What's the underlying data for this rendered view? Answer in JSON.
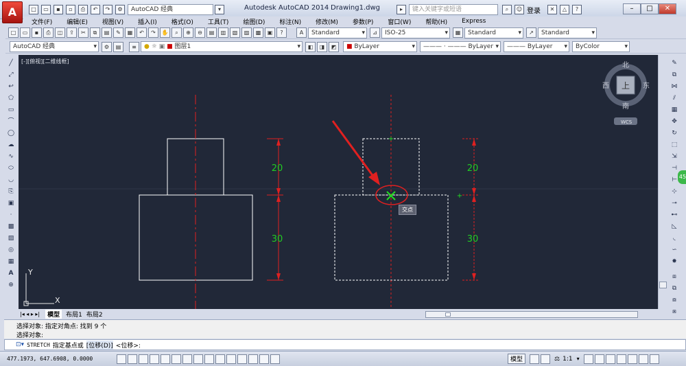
{
  "app": {
    "title": "Autodesk AutoCAD 2014",
    "document": "Drawing1.dwg",
    "workspace": "AutoCAD 经典",
    "search_placeholder": "键入关键字或短语",
    "login_label": "登录",
    "help_icon": "?"
  },
  "menu": [
    "文件(F)",
    "编辑(E)",
    "视图(V)",
    "插入(I)",
    "格式(O)",
    "工具(T)",
    "绘图(D)",
    "标注(N)",
    "修改(M)",
    "参数(P)",
    "窗口(W)",
    "帮助(H)",
    "Express"
  ],
  "styles": {
    "text_style": "Standard",
    "dim_style": "ISO-25",
    "table_style": "Standard",
    "multileader_style": "Standard"
  },
  "layers": {
    "workspace": "AutoCAD 经典",
    "current_layer": "图层1",
    "color": "ByLayer",
    "linetype": "ByLayer",
    "lineweight": "ByLayer",
    "plotstyle": "ByColor"
  },
  "viewport": {
    "label": "[-][俯视][二维线框]",
    "viewcube": {
      "north": "北",
      "south": "南",
      "east": "东",
      "west": "西",
      "top": "上",
      "wcs": "WCS"
    },
    "ucs": {
      "x": "X",
      "y": "Y"
    },
    "dims_left": {
      "upper": "20",
      "lower": "30"
    },
    "dims_right": {
      "upper": "20",
      "lower": "30"
    },
    "snap_tooltip": "交点"
  },
  "tabs": [
    "模型",
    "布局1",
    "布局2"
  ],
  "command": {
    "history": [
      "选择对象: 指定对角点: 找到 9 个",
      "选择对象:"
    ],
    "prompt_command": "STRETCH",
    "prompt_text": "指定基点或",
    "prompt_option": "[位移(D)]",
    "prompt_default": "<位移>:"
  },
  "status": {
    "coordinates": "477.1973, 647.6908, 0.0000",
    "model_label": "模型",
    "scale": "1:1"
  },
  "colors": {
    "background": "#212838",
    "geometry": "#ffffff",
    "centerline": "#e02020",
    "dimension_text": "#22cc22",
    "snap_marker": "#22dd22"
  }
}
